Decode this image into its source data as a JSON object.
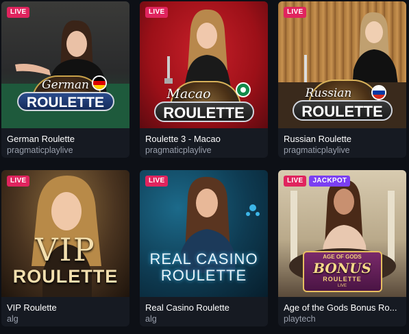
{
  "games": [
    {
      "title": "German Roulette",
      "provider": "pragmaticplaylive",
      "badges": [
        "LIVE"
      ],
      "logo_script": "German",
      "logo_main": "ROULETTE",
      "flag": "germany-flag",
      "bg": "#2a2b2c"
    },
    {
      "title": "Roulette 3 - Macao",
      "provider": "pragmaticplaylive",
      "badges": [
        "LIVE"
      ],
      "logo_script": "Macao",
      "logo_main": "ROULETTE",
      "flag": "macao-flag",
      "bg": "#a5121b"
    },
    {
      "title": "Russian Roulette",
      "provider": "pragmaticplaylive",
      "badges": [
        "LIVE"
      ],
      "logo_script": "Russian",
      "logo_main": "ROULETTE",
      "flag": "russia-flag",
      "bg": "#8a5a2b"
    },
    {
      "title": "VIP Roulette",
      "provider": "alg",
      "badges": [
        "LIVE"
      ],
      "logo_script": "VIP",
      "logo_main": "ROULETTE",
      "bg": "#5a4326"
    },
    {
      "title": "Real Casino Roulette",
      "provider": "alg",
      "badges": [
        "LIVE"
      ],
      "logo_script": "REAL CASINO",
      "logo_main": "ROULETTE",
      "bg": "#0e3b52"
    },
    {
      "title": "Age of the Gods Bonus Ro...",
      "provider": "playtech",
      "badges": [
        "LIVE",
        "JACKPOT"
      ],
      "logo_top": "AGE OF GODS",
      "logo_script": "BONUS",
      "logo_main": "ROULETTE",
      "logo_sub": "LIVE",
      "bg": "#b9a98a"
    }
  ],
  "colors": {
    "page_bg": "#0d1016",
    "card_bg": "#161a22",
    "live": "#e0245e",
    "jackpot": "#7b3ff2",
    "provider_text": "#9aa0ad"
  }
}
